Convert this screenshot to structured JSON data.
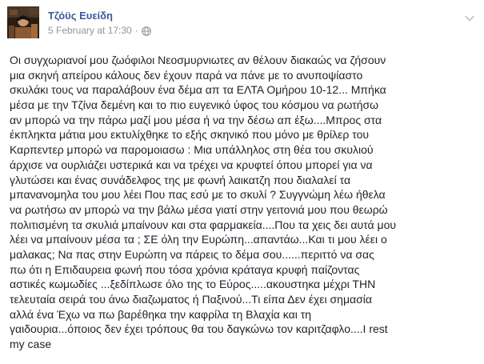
{
  "post": {
    "author": "Τζόϋς Ευείδη",
    "timestamp": "5 February at 17:30",
    "separator": "·",
    "privacy_icon": "globe-icon",
    "menu_icon": "chevron-down-icon",
    "body_lines": [
      "Οι συγχωριανοί μου ζωόφιλοι Νεοσμυρνιωτες αν θέλουν διακαώς να ζήσουν",
      "μια σκηνή απείρου κάλους δεν έχουν παρά να πάνε με το ανυποψίαστο",
      "σκυλάκι τους να παραλάβουν ένα δέμα απ τα ΕΛΤΑ Ομήρου 10-12... Μπήκα",
      "μέσα με την Τζίνα δεμένη και το πιο ευγενικό ύφος του κόσμου να ρωτήσω",
      "αν μπορώ να την πάρω μαζί μου μέσα ή να την δέσω απ έξω....Μπρος στα",
      "έκπληκτα μάτια μου εκτυλίχθηκε το εξής σκηνικό που μόνο με θρίλερ του",
      "Καρπεντερ μπορώ να παρομοιασω : Μια υπάλληλος στη θέα του σκυλιού",
      "άρχισε να ουρλιάζει υστερικά και να τρέχει να κρυφτεί όπου μπορεί για να",
      "γλυτώσει και ένας συνάδελφος της με φωνή λαικατζη που διαλαλεί τα",
      "μπανανομηλα του μου λέει Που πας εσύ με το σκυλί ? Συγγνώμη λέω ήθελα",
      "να ρωτήσω αν μπορώ να την βάλω μέσα γιατί στην γειτονιά μου που θεωρώ",
      "πολιτισμένη τα σκυλιά μπαίνουν και στα φαρμακεία....Που τα χεις δει αυτά μου",
      "λέει να μπαίνουν μέσα τα ; ΣΕ όλη την Ευρώπη...απαντάω...Και τι μου λέει ο",
      "μαλακας; Να πας στην Ευρώπη να πάρεις το δέμα σου......περιττό να σας",
      "πω ότι η Επιδαυρεια φωνή που τόσα χρόνια κράταγα κρυφή παίζοντας",
      "αστικές κωμωδίες ...ξεδίπλωσε όλο της το Εύρος.....ακουστηκα μέχρι ΤΗΝ",
      "τελευταία σειρά του άνω διαζωματος ή Παξινού...Τι είπα Δεν έχει σημασία",
      "αλλά ένα Έχω να πω βαρέθηκα την καφρίλα τη Βλαχία και τη",
      "γαιδουρια...όποιος δεν έχει τρόπους θα του δαγκώνω τον καριτζαφλο....I rest",
      "my case"
    ]
  },
  "colors": {
    "author_link": "#3b5998",
    "meta_text": "#90949c",
    "body_text": "#1d2129"
  }
}
